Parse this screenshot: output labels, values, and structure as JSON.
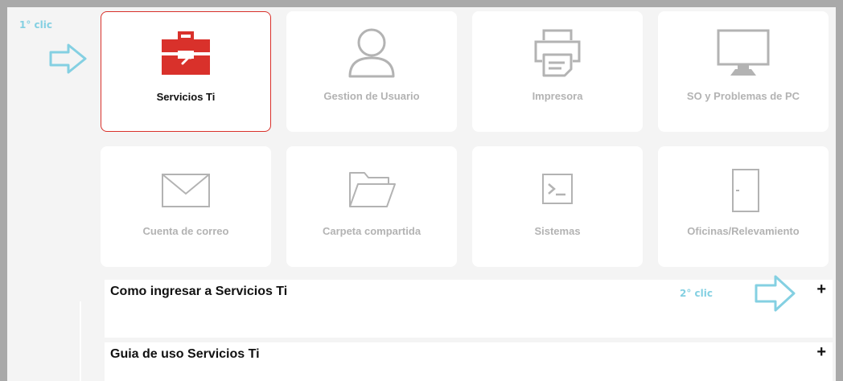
{
  "annotations": {
    "first_click": "1° clic",
    "second_click": "2° clic",
    "arrow_color": "#84d0e2"
  },
  "tiles": [
    {
      "label": "Servicios Ti",
      "icon": "toolbox-icon",
      "active": true
    },
    {
      "label": "Gestion de Usuario",
      "icon": "user-icon",
      "active": false
    },
    {
      "label": "Impresora",
      "icon": "printer-icon",
      "active": false
    },
    {
      "label": "SO y Problemas de PC",
      "icon": "monitor-icon",
      "active": false
    },
    {
      "label": "Cuenta de correo",
      "icon": "envelope-icon",
      "active": false
    },
    {
      "label": "Carpeta compartida",
      "icon": "folder-icon",
      "active": false
    },
    {
      "label": "Sistemas",
      "icon": "terminal-icon",
      "active": false
    },
    {
      "label": "Oficinas/Relevamiento",
      "icon": "door-icon",
      "active": false
    }
  ],
  "accordion": [
    {
      "title": "Como ingresar a Servicios Ti",
      "toggle": "+"
    },
    {
      "title": "Guia de uso Servicios Ti",
      "toggle": "+"
    }
  ],
  "colors": {
    "accent": "#d9312b",
    "muted": "#b3b3b3"
  }
}
